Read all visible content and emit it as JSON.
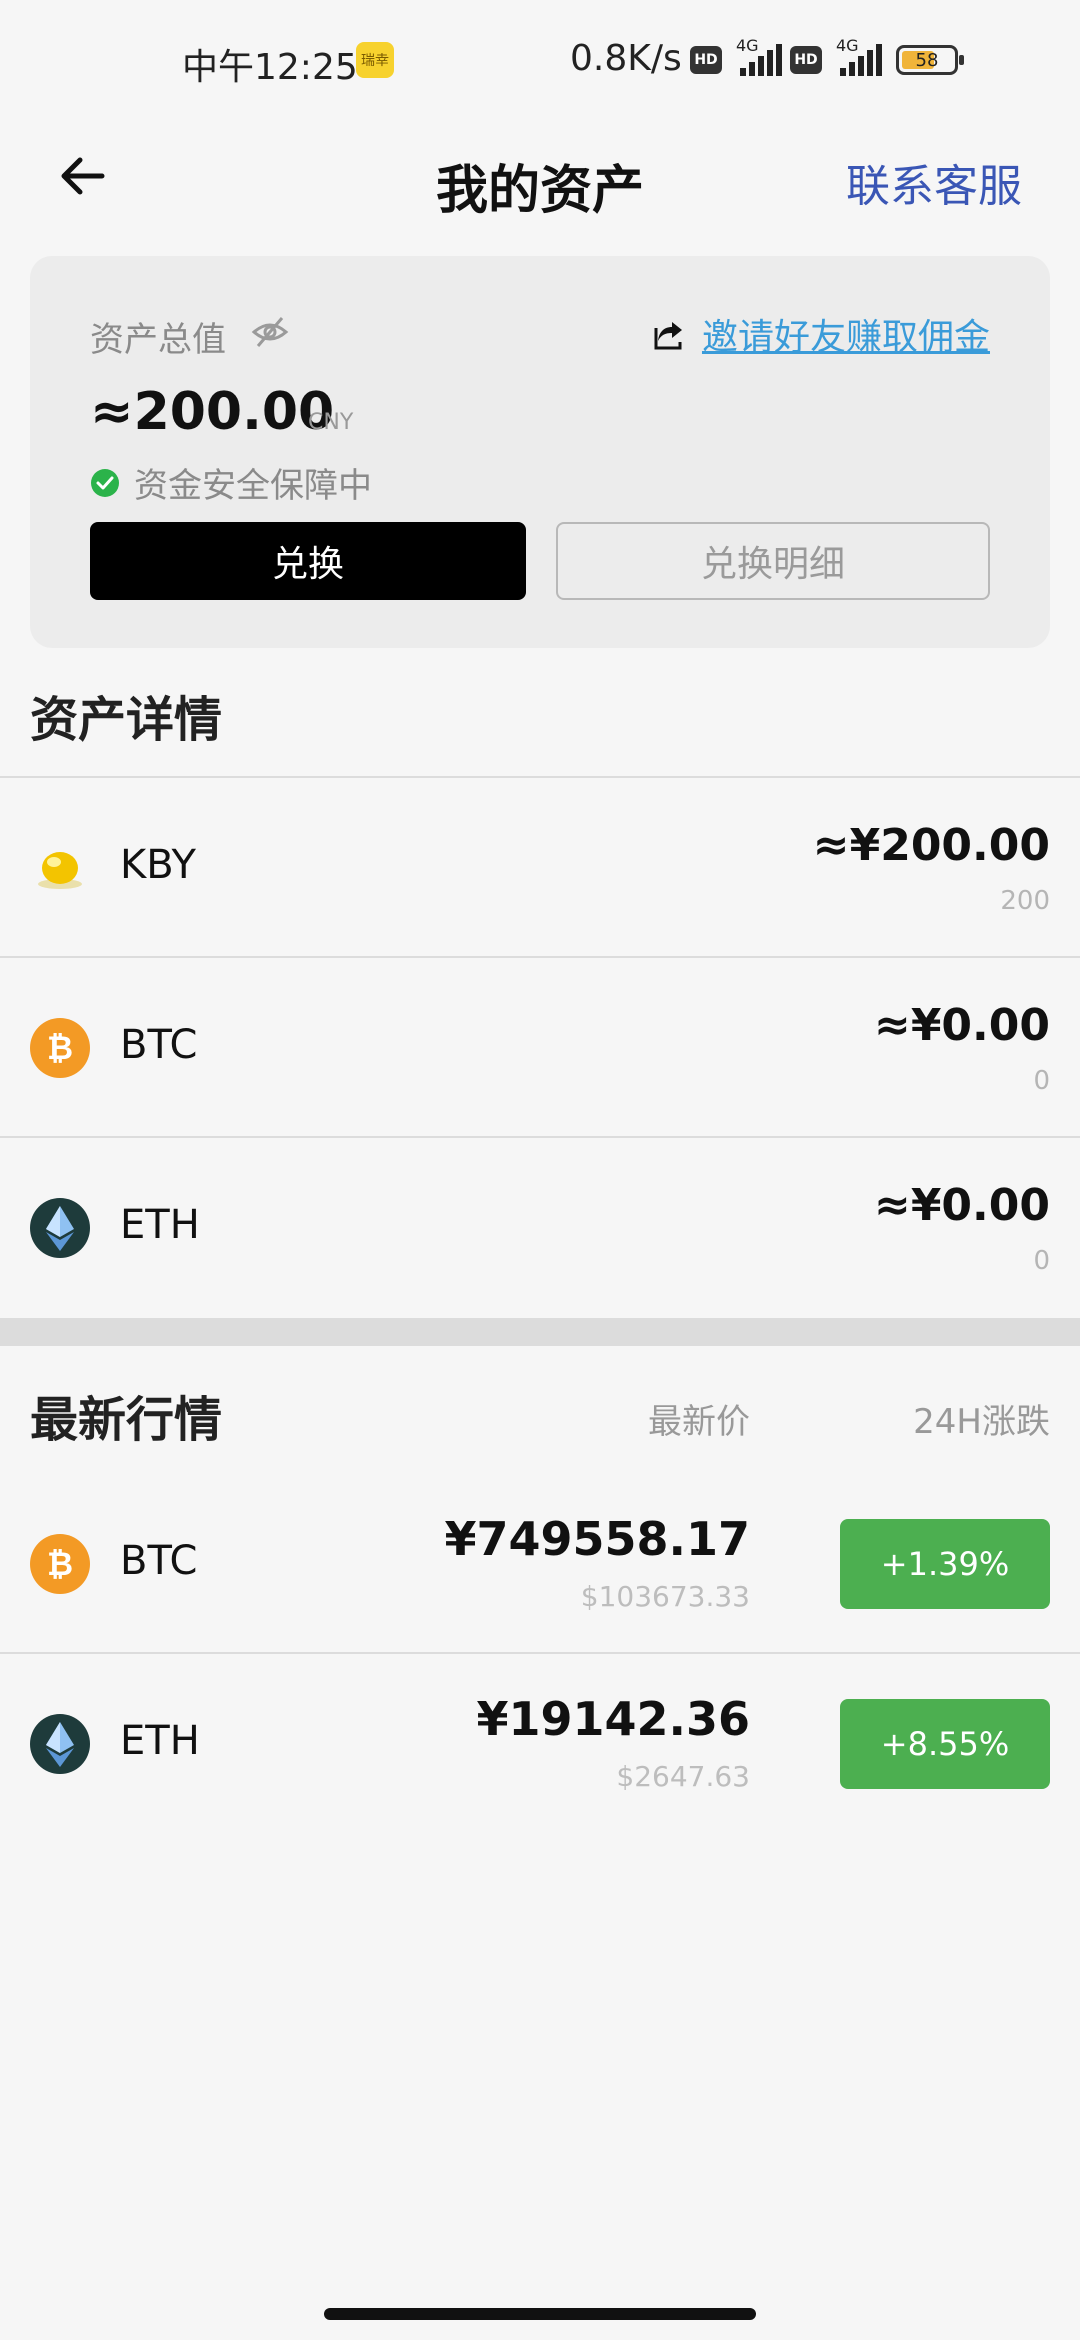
{
  "status_bar": {
    "time": "中午12:25",
    "badge": "瑞幸",
    "speed": "0.8K/s",
    "hd1": "HD",
    "hd2": "HD",
    "net1": "4G",
    "net2": "4G",
    "battery": "58"
  },
  "header": {
    "title": "我的资产",
    "contact": "联系客服",
    "back_icon": "arrow-left-icon"
  },
  "asset_card": {
    "total_label": "资产总值",
    "eye_icon": "eye-off-icon",
    "invite_text": "邀请好友赚取佣金",
    "total_value": "≈200.00",
    "total_unit": "CNY",
    "secure_text": "资金安全保障中",
    "exchange_button": "兑换",
    "detail_button": "兑换明细"
  },
  "assets_section": {
    "title": "资产详情",
    "items": [
      {
        "name": "KBY",
        "value": "≈¥200.00",
        "amount": "200",
        "icon": "kby-coin-icon"
      },
      {
        "name": "BTC",
        "value": "≈¥0.00",
        "amount": "0",
        "icon": "btc-coin-icon"
      },
      {
        "name": "ETH",
        "value": "≈¥0.00",
        "amount": "0",
        "icon": "eth-coin-icon"
      }
    ]
  },
  "market_section": {
    "title": "最新行情",
    "col_price": "最新价",
    "col_change": "24H涨跌",
    "items": [
      {
        "name": "BTC",
        "price_cny": "¥749558.17",
        "price_usd": "$103673.33",
        "change": "+1.39%",
        "icon": "btc-coin-icon"
      },
      {
        "name": "ETH",
        "price_cny": "¥19142.36",
        "price_usd": "$2647.63",
        "change": "+8.55%",
        "icon": "eth-coin-icon"
      }
    ]
  },
  "colors": {
    "accent_link": "#3a56b5",
    "invite_link": "#3a9bd9",
    "positive": "#4caf50",
    "btc": "#f39a25",
    "eth_bg": "#1e3b3b"
  }
}
